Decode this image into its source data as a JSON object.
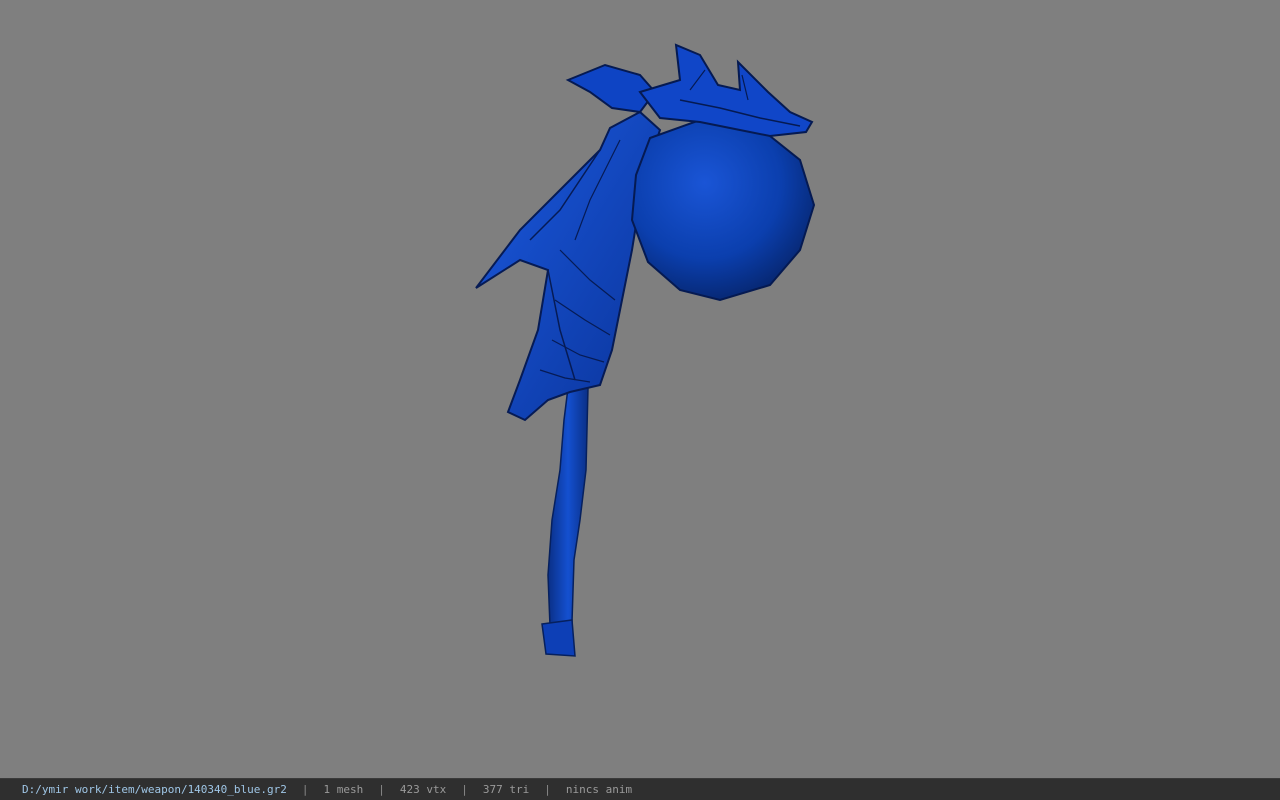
{
  "viewport": {
    "background_color": "#7f7f7f",
    "model": {
      "description": "blue textured 3D weapon model (feathered staff with orb head)",
      "color": "#0a3fc0"
    }
  },
  "statusbar": {
    "file_path": "D:/ymir work/item/weapon/140340_blue.gr2",
    "separator": "|",
    "mesh_count": "1 mesh",
    "vertex_count": "423 vtx",
    "triangle_count": "377 tri",
    "anim_status": "nincs anim"
  }
}
